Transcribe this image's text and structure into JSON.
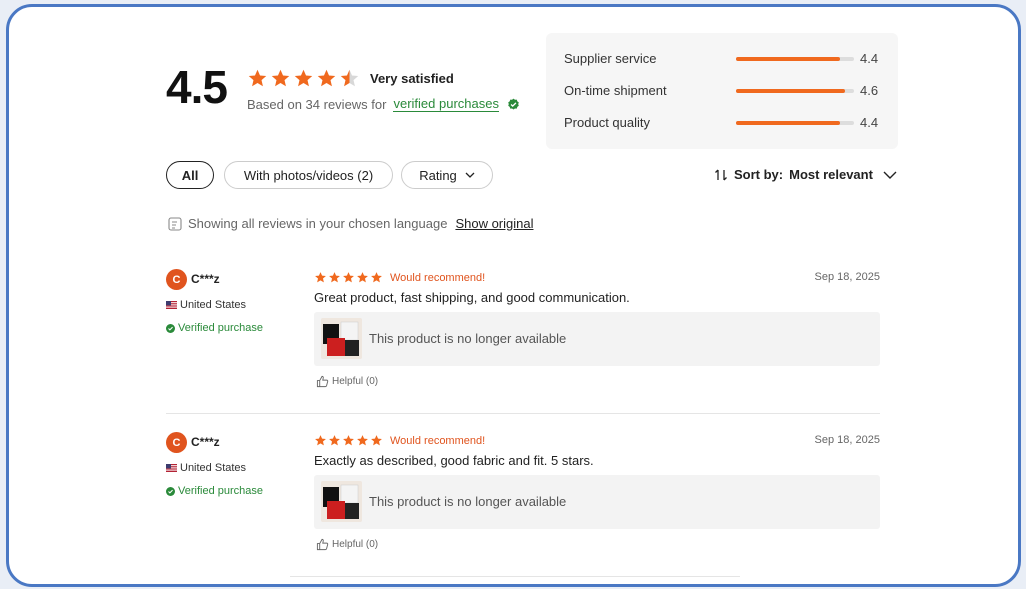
{
  "summary": {
    "rating": "4.5",
    "stars_filled": 4.5,
    "satisfaction": "Very satisfied",
    "based_prefix": "Based on 34 reviews for",
    "verified_link": "verified purchases"
  },
  "scores": [
    {
      "label": "Supplier service",
      "value": "4.4",
      "level": 0.88
    },
    {
      "label": "On-time shipment",
      "value": "4.6",
      "level": 0.92
    },
    {
      "label": "Product quality",
      "value": "4.4",
      "level": 0.88
    }
  ],
  "filters": {
    "all": "All",
    "photos": "With photos/videos (2)",
    "rating": "Rating"
  },
  "sort": {
    "prefix": "Sort by:",
    "value": "Most relevant"
  },
  "language": {
    "notice": "Showing all reviews in your chosen language",
    "show_original": "Show original"
  },
  "colors": {
    "accent": "#f0691e",
    "verified": "#2a8a3a",
    "frame": "#4a78c4"
  },
  "reviews": [
    {
      "avatar_letter": "C",
      "user": "C***z",
      "country": "United States",
      "verified": "Verified purchase",
      "stars": 5,
      "recommend": "Would recommend!",
      "date": "Sep 18, 2025",
      "text": "Great product, fast shipping, and good communication.",
      "product_note": "This product is no longer available",
      "helpful": "Helpful (0)"
    },
    {
      "avatar_letter": "C",
      "user": "C***z",
      "country": "United States",
      "verified": "Verified purchase",
      "stars": 5,
      "recommend": "Would recommend!",
      "date": "Sep 18, 2025",
      "text": "Exactly as described, good fabric and fit. 5 stars.",
      "product_note": "This product is no longer available",
      "helpful": "Helpful (0)"
    }
  ]
}
